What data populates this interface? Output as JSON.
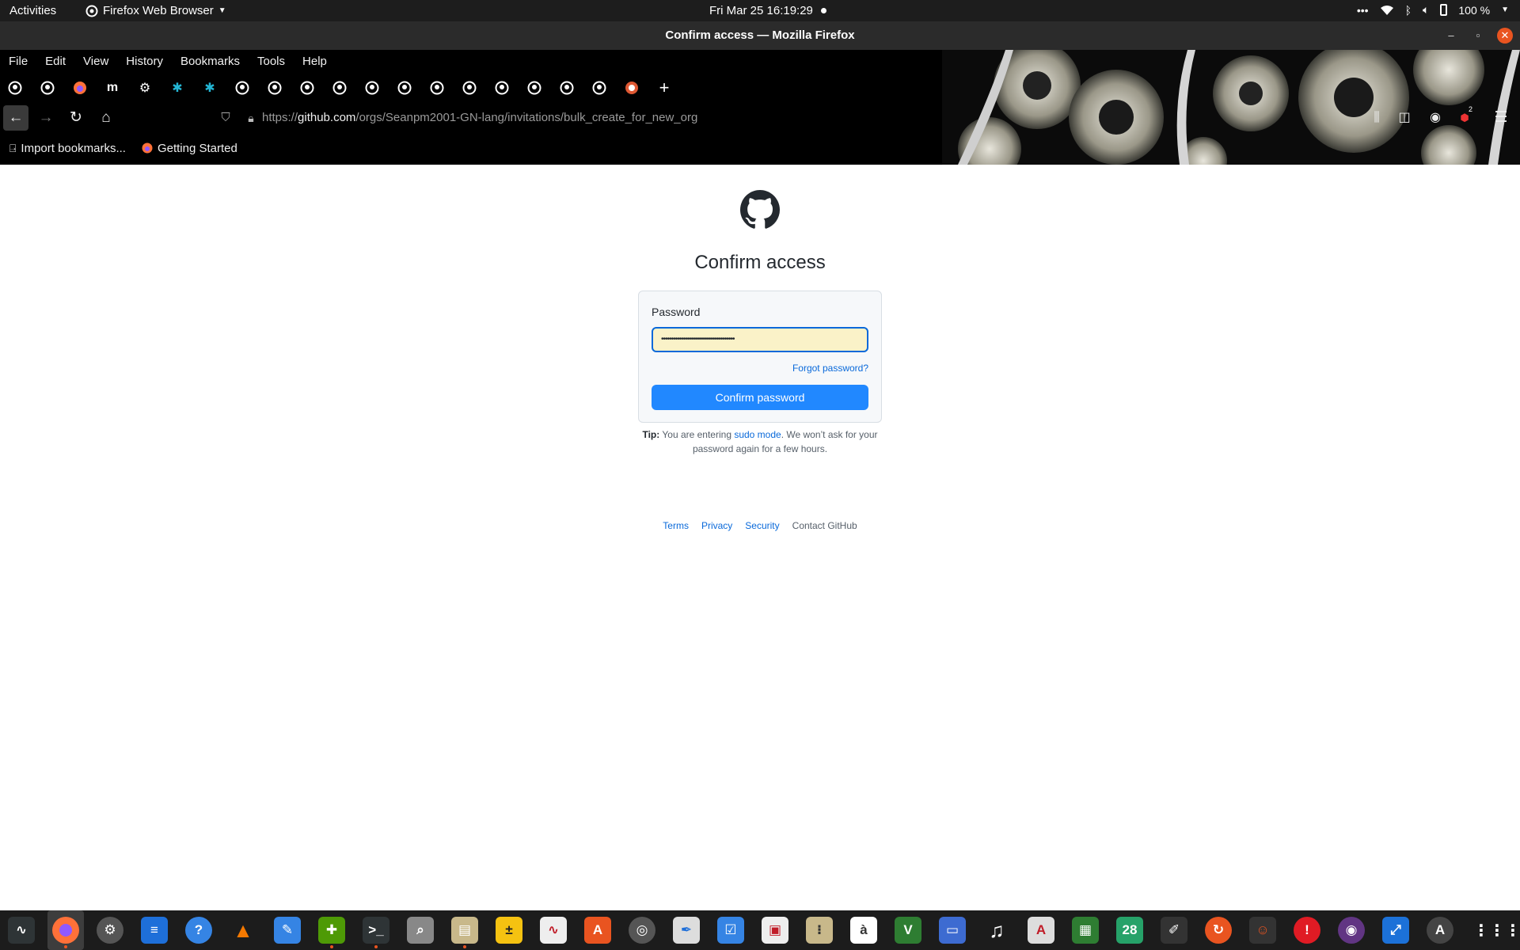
{
  "topbar": {
    "activities": "Activities",
    "app_menu": "Firefox Web Browser",
    "clock": "Fri Mar 25  16:19:29",
    "battery": "100 %"
  },
  "window": {
    "title": "Confirm access — Mozilla Firefox"
  },
  "menubar": {
    "items": [
      "File",
      "Edit",
      "View",
      "History",
      "Bookmarks",
      "Tools",
      "Help"
    ]
  },
  "tabs": {
    "icons": [
      "github-icon",
      "github-icon",
      "firefox-icon",
      "m-icon",
      "gear-icon",
      "puzzle-icon",
      "puzzle-icon",
      "github-icon",
      "github-icon",
      "github-icon",
      "github-icon",
      "github-icon",
      "github-icon",
      "github-icon",
      "github-icon",
      "github-icon",
      "github-icon",
      "github-icon",
      "github-icon",
      "duckduckgo-icon"
    ],
    "m_glyph": "m"
  },
  "navbar": {
    "url_prefix": "https://",
    "url_domain": "github.com",
    "url_path": "/orgs/Seanpm2001-GN-lang/invitations/bulk_create_for_new_org",
    "badge": "2"
  },
  "bookmarks": {
    "items": [
      "Import bookmarks...",
      "Getting Started"
    ]
  },
  "page": {
    "heading": "Confirm access",
    "password_label": "Password",
    "password_value": "•••••••••••••••••••••••••••••••••••••",
    "forgot_link": "Forgot password?",
    "confirm_button": "Confirm password",
    "tip_label": "Tip:",
    "tip_text_before": " You are entering ",
    "tip_link": "sudo mode",
    "tip_text_after": ". We won’t ask for your password again for a few hours.",
    "footer": {
      "terms": "Terms",
      "privacy": "Privacy",
      "security": "Security",
      "contact": "Contact GitHub"
    }
  },
  "dock": {
    "calendar_day": "28"
  },
  "colors": {
    "accent": "#2188ff",
    "link": "#0969da",
    "input_bg": "#faf2c8",
    "ubuntu_orange": "#e95420"
  }
}
